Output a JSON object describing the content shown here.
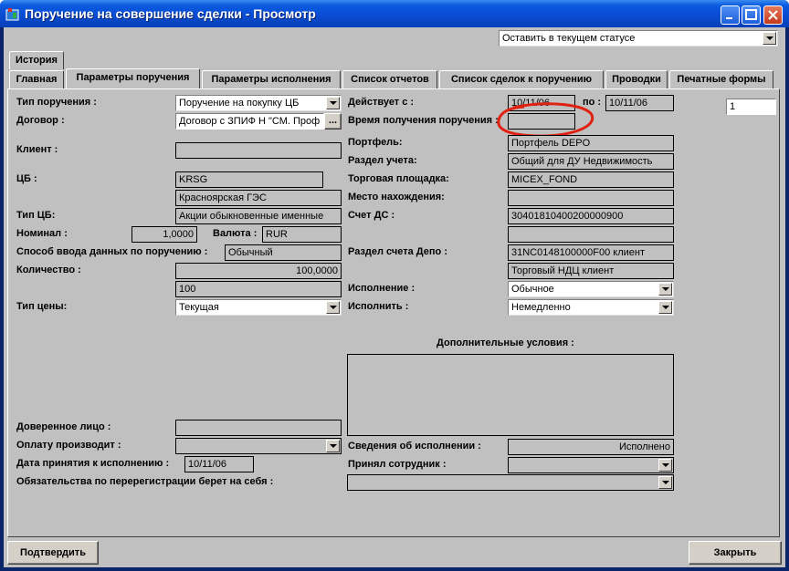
{
  "window": {
    "title": "Поручение на совершение сделки - Просмотр"
  },
  "status_combo": {
    "value": "Оставить в текущем статусе"
  },
  "history_tab": "История",
  "tabs": [
    "Главная",
    "Параметры поручения",
    "Параметры исполнения",
    "Список отчетов",
    "Список сделок к поручению",
    "Проводки",
    "Печатные формы"
  ],
  "left": {
    "order_type_label": "Тип поручения :",
    "order_type_value": "Поручение на покупку ЦБ",
    "contract_label": "Договор :",
    "contract_value": "Договор с ЗПИФ Н \"СМ. Проф",
    "contract_btn": "...",
    "client_label": "Клиент :",
    "client_value": "",
    "security_label": "ЦБ :",
    "security_code": "KRSG",
    "security_name": "Красноярская ГЭС",
    "security_type_label": "Тип ЦБ:",
    "security_type_value": "Акции обыкновенные именные",
    "nominal_label": "Номинал :",
    "nominal_value": "1,0000",
    "currency_label": "Валюта :",
    "currency_value": "RUR",
    "input_method_label": "Способ ввода данных по поручению :",
    "input_method_value": "Обычный",
    "quantity_label": "Количество :",
    "quantity_value": "100,0000",
    "quantity_int": "100",
    "price_type_label": "Тип цены:",
    "price_type_value": "Текущая",
    "proxy_label": "Доверенное лицо :",
    "proxy_value": "",
    "payer_label": "Оплату производит :",
    "payer_value": "",
    "accept_date_label": "Дата принятия к исполнению :",
    "accept_date_value": "10/11/06",
    "obligations_label": "Обязательства по перерегистрации берет на себя :",
    "obligations_value": ""
  },
  "right": {
    "valid_label": "Действует с :",
    "valid_from": "10/11/06",
    "to_label": "по :",
    "valid_to": "10/11/06",
    "counter_value": "1",
    "receive_time_label": "Время получения поручения :",
    "receive_time_value": "",
    "portfolio_label": "Портфель:",
    "portfolio_value": "Портфель DEPO",
    "account_section_label": "Раздел учета:",
    "account_section_value": "Общий для ДУ Недвижимость",
    "trade_place_label": "Торговая площадка:",
    "trade_place_value": "MICEX_FOND",
    "location_label": "Место нахождения:",
    "location_value": "",
    "cash_account_label": "Счет ДС :",
    "cash_account_value": "30401810400200000900",
    "cash_account_extra": "",
    "depo_section_label": "Раздел счета Депо :",
    "depo_section_value": "31NC0148100000F00 клиент",
    "depo_section_name": "Торговый НДЦ клиент",
    "execution_label": "Исполнение :",
    "execution_value": "Обычное",
    "execute_label": "Исполнить :",
    "execute_value": "Немедленно",
    "extra_conditions_label": "Дополнительные условия :",
    "exec_info_label": "Сведения об исполнении :",
    "exec_info_value": "Исполнено",
    "accepted_by_label": "Принял сотрудник :",
    "accepted_by_value": ""
  },
  "buttons": {
    "confirm": "Подтвердить",
    "close": "Закрыть"
  },
  "colors": {
    "titlebar": "#0a4bd0",
    "face": "#c0c0c0",
    "annotation": "#e02010"
  }
}
